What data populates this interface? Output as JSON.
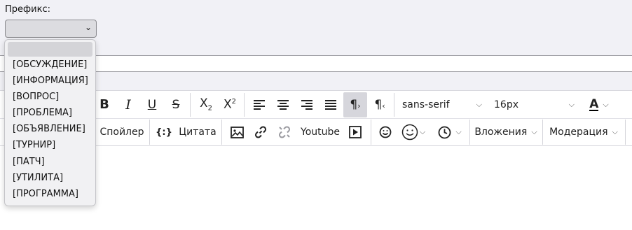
{
  "prefix": {
    "label": "Префикс:",
    "selected": "",
    "options": [
      "",
      "[ОБСУЖДЕНИЕ]",
      "[ИНФОРМАЦИЯ]",
      "[ВОПРОС]",
      "[ПРОБЛЕМА]",
      "[ОБЪЯВЛЕНИЕ]",
      "[ТУРНИР]",
      "[ПАТЧ]",
      "[УТИЛИТА]",
      "[ПРОГРАММА]"
    ]
  },
  "toolbar": {
    "font_family": "sans-serif",
    "font_size": "16px",
    "font_color_letter": "A",
    "spoiler": "Спойлер",
    "quote": "Цитата",
    "youtube": "Youtube",
    "attachments": "Вложения",
    "moderation": "Модерация"
  },
  "colors": {
    "page_bg": "#f1f1f6",
    "active_button": "#d6d6dc",
    "font_color_underline": "#000000"
  },
  "icons": [
    "bold-icon",
    "italic-icon",
    "underline-icon",
    "strikethrough-icon",
    "subscript-icon",
    "superscript-icon",
    "align-left-icon",
    "align-center-icon",
    "align-right-icon",
    "justify-icon",
    "ltr-icon",
    "rtl-icon",
    "code-icon",
    "image-icon",
    "link-icon",
    "unlink-icon",
    "media-icon",
    "smilie-icon",
    "emoji-icon",
    "clock-icon"
  ]
}
